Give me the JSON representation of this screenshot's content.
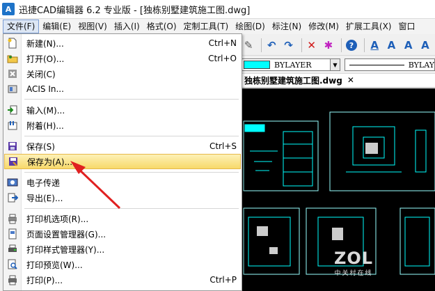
{
  "window": {
    "logo": "A",
    "title": "迅捷CAD编辑器 6.2 专业版  - [独栋别墅建筑施工图.dwg]"
  },
  "menubar": [
    {
      "label": "文件(F)"
    },
    {
      "label": "编辑(E)"
    },
    {
      "label": "视图(V)"
    },
    {
      "label": "插入(I)"
    },
    {
      "label": "格式(O)"
    },
    {
      "label": "定制工具(T)"
    },
    {
      "label": "绘图(D)"
    },
    {
      "label": "标注(N)"
    },
    {
      "label": "修改(M)"
    },
    {
      "label": "扩展工具(X)"
    },
    {
      "label": "窗口"
    }
  ],
  "toolbar": {
    "layer_value": "BYLAYER",
    "linetype_value": "BYLAY"
  },
  "tab": {
    "label": "独栋别墅建筑施工图.dwg",
    "close": "✕"
  },
  "file_menu": {
    "items": [
      {
        "label": "新建(N)...",
        "shortcut": "Ctrl+N"
      },
      {
        "label": "打开(O)...",
        "shortcut": "Ctrl+O"
      },
      {
        "label": "关闭(C)",
        "shortcut": ""
      },
      {
        "label": "ACIS In...",
        "shortcut": ""
      },
      {
        "label": "输入(M)...",
        "shortcut": ""
      },
      {
        "label": "附着(H)...",
        "shortcut": ""
      },
      {
        "label": "保存(S)",
        "shortcut": "Ctrl+S"
      },
      {
        "label": "保存为(A)...",
        "shortcut": ""
      },
      {
        "label": "电子传递",
        "shortcut": ""
      },
      {
        "label": "导出(E)...",
        "shortcut": ""
      },
      {
        "label": "打印机选项(R)...",
        "shortcut": ""
      },
      {
        "label": "页面设置管理器(G)...",
        "shortcut": ""
      },
      {
        "label": "打印样式管理器(Y)...",
        "shortcut": ""
      },
      {
        "label": "打印预览(W)...",
        "shortcut": ""
      },
      {
        "label": "打印(P)...",
        "shortcut": "Ctrl+P"
      }
    ]
  },
  "watermark": {
    "main": "ZOL",
    "sub": "中关村在线"
  },
  "colors": {
    "highlight": "#f7d96a",
    "annotation_arrow": "#e02020",
    "cad_lines": "#00ffff",
    "canvas": "#000000"
  }
}
